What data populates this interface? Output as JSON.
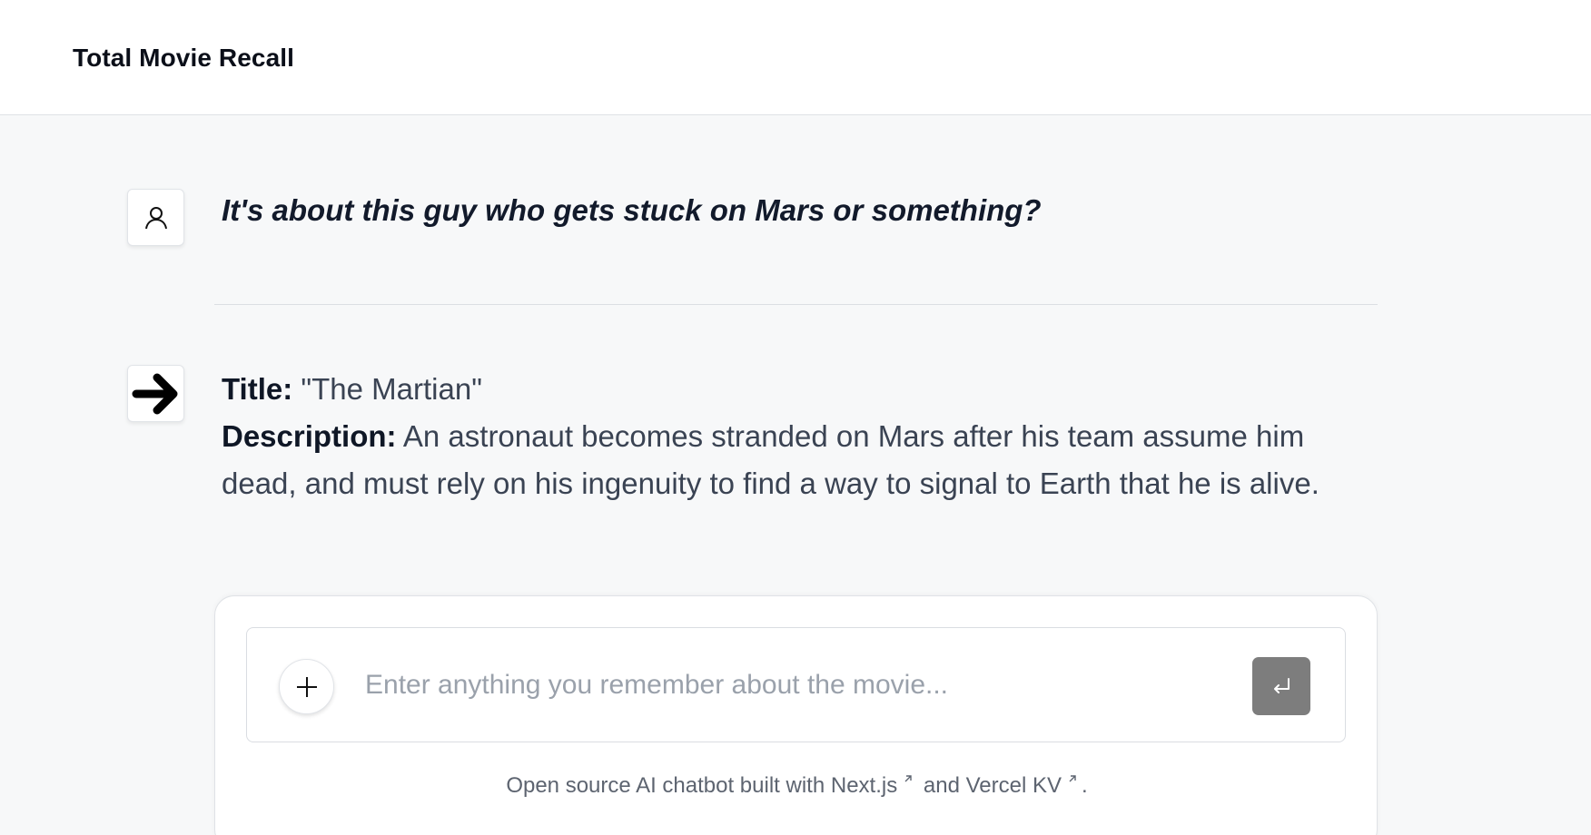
{
  "header": {
    "title": "Total Movie Recall"
  },
  "conversation": {
    "user_message": "It's about this guy who gets stuck on Mars or something?",
    "bot_message": {
      "title_label": "Title:",
      "title_value": "\"The Martian\"",
      "description_label": "Description:",
      "description_value": "An astronaut becomes stranded on Mars after his team assume him dead, and must rely on his ingenuity to find a way to signal to Earth that he is alive."
    }
  },
  "composer": {
    "placeholder": "Enter anything you remember about the movie...",
    "value": ""
  },
  "footer": {
    "prefix": "Open source AI chatbot built with ",
    "link_nextjs": "Next.js",
    "middle": " and ",
    "link_vercel_kv": "Vercel KV",
    "suffix": "."
  },
  "icons": {
    "user_avatar": "user-icon",
    "bot_avatar": "arrow-right-icon",
    "new_chat": "plus-icon",
    "send": "enter-icon",
    "external_link": "external-link-icon"
  },
  "colors": {
    "background": "#f7f8f9",
    "send_button": "#7d7d7d",
    "text_primary": "#0f1726",
    "text_secondary": "#3a4353"
  }
}
